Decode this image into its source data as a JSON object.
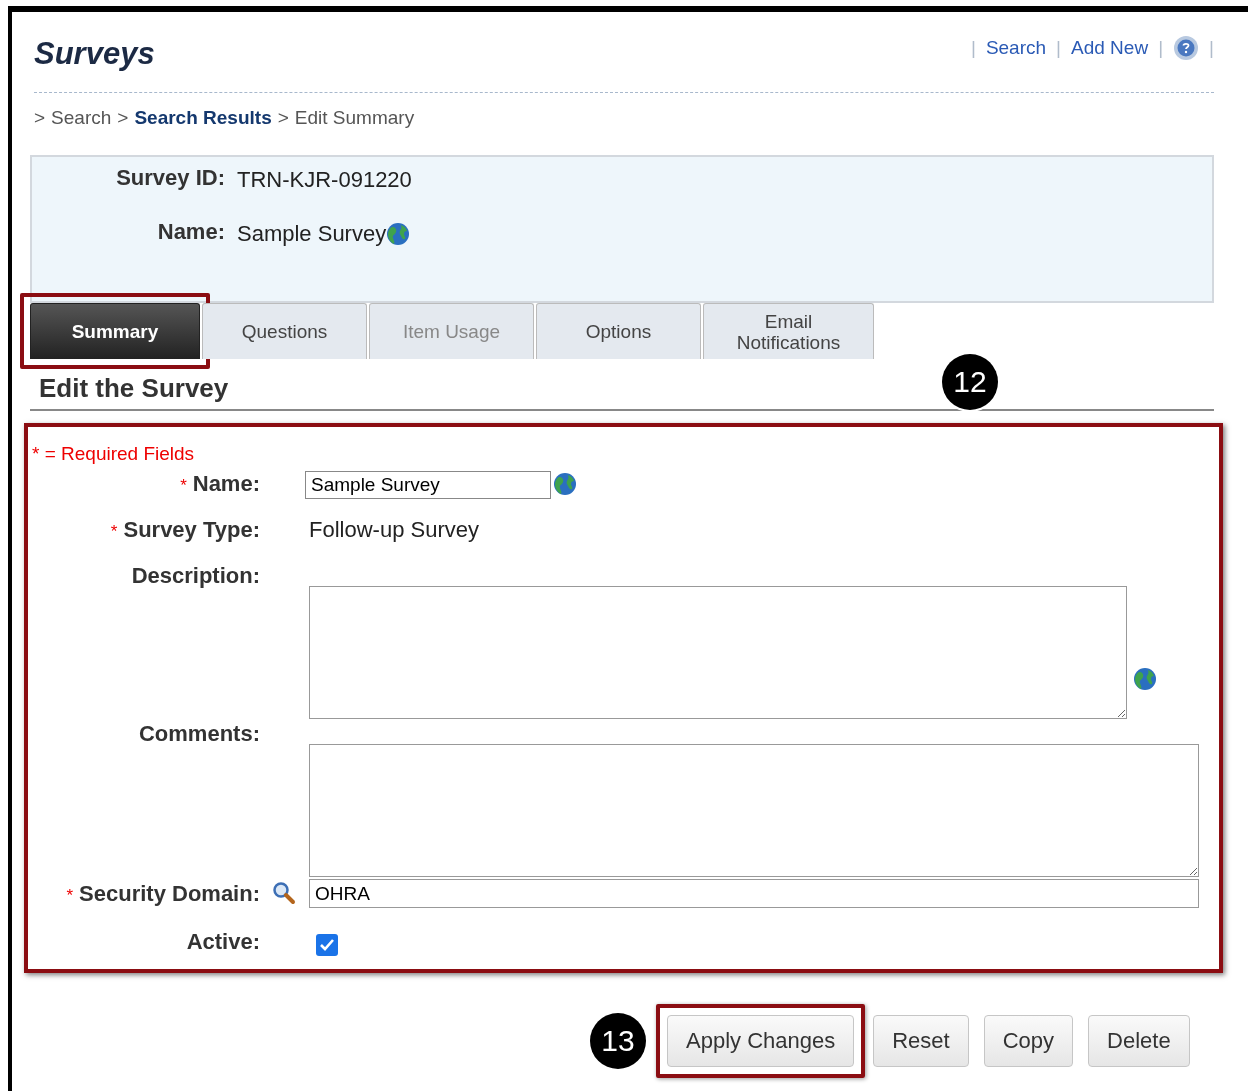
{
  "header": {
    "title": "Surveys",
    "link_separator": "|",
    "links": [
      {
        "label": "Search"
      },
      {
        "label": "Add New"
      }
    ]
  },
  "breadcrumb": {
    "separator": ">",
    "items": [
      {
        "label": "Search",
        "kind": "plain"
      },
      {
        "label": "Search Results",
        "kind": "link"
      },
      {
        "label": "Edit Summary",
        "kind": "plain"
      }
    ]
  },
  "summary": [
    {
      "label": "Survey ID:",
      "value": "TRN-KJR-091220",
      "translatable": false
    },
    {
      "label": "Name:",
      "value": "Sample Survey",
      "translatable": true
    }
  ],
  "tabs": [
    {
      "label": "Summary",
      "selected": true,
      "disabled": false,
      "highlighted": true
    },
    {
      "label": "Questions",
      "selected": false,
      "disabled": false,
      "highlighted": false
    },
    {
      "label": "Item Usage",
      "selected": false,
      "disabled": true,
      "highlighted": false
    },
    {
      "label": "Options",
      "selected": false,
      "disabled": false,
      "highlighted": false
    },
    {
      "label": "Email Notifications",
      "selected": false,
      "disabled": false,
      "highlighted": false
    }
  ],
  "section_title": "Edit the Survey",
  "form": {
    "highlighted": true,
    "required_note": "* = Required Fields",
    "required_mark": "*",
    "fields": [
      {
        "kind": "text",
        "label": "Name:",
        "required": true,
        "value": "Sample Survey",
        "translatable": true
      },
      {
        "kind": "static",
        "label": "Survey Type:",
        "required": true,
        "value": "Follow-up Survey",
        "translatable": false
      },
      {
        "kind": "textarea",
        "label": "Description:",
        "required": false,
        "translatable": true,
        "wide": false
      },
      {
        "kind": "textarea",
        "label": "Comments:",
        "required": false,
        "translatable": false,
        "wide": true
      },
      {
        "kind": "lookup",
        "label": "Security Domain:",
        "required": true,
        "value": "OHRA",
        "translatable": false
      },
      {
        "kind": "checkbox",
        "label": "Active:",
        "required": false,
        "checked": true,
        "translatable": false
      }
    ]
  },
  "buttons": [
    {
      "label": "Apply Changes",
      "highlighted": true
    },
    {
      "label": "Reset",
      "highlighted": false
    },
    {
      "label": "Copy",
      "highlighted": false
    },
    {
      "label": "Delete",
      "highlighted": false
    }
  ],
  "callouts": [
    {
      "number": "12"
    },
    {
      "number": "13"
    }
  ]
}
